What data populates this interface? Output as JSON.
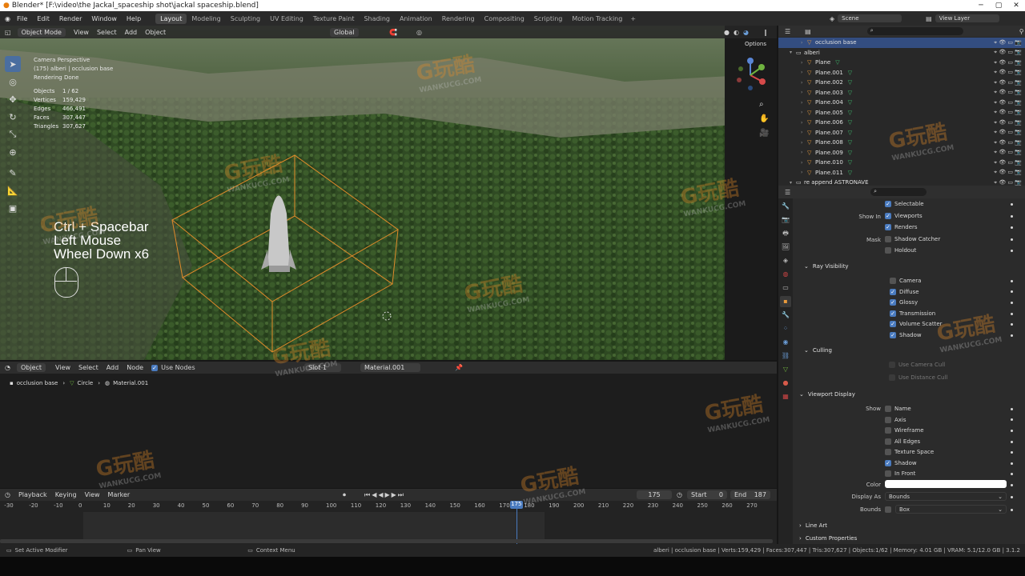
{
  "window": {
    "title": "Blender* [F:\\video\\the Jackal_spaceship shot\\jackal spaceship.blend]"
  },
  "menu": [
    "File",
    "Edit",
    "Render",
    "Window",
    "Help"
  ],
  "workspaces": [
    "Layout",
    "Modeling",
    "Sculpting",
    "UV Editing",
    "Texture Paint",
    "Shading",
    "Animation",
    "Rendering",
    "Compositing",
    "Scripting",
    "Motion Tracking"
  ],
  "active_workspace": "Layout",
  "topright": {
    "scene": "Scene",
    "view_layer": "View Layer"
  },
  "viewport": {
    "mode": "Object Mode",
    "menus": [
      "View",
      "Select",
      "Add",
      "Object"
    ],
    "transform": "Global",
    "options": "Options",
    "overlay_lines": [
      "Camera Perspective",
      "(175) alberi | occlusion base",
      "Rendering Done"
    ],
    "stats": [
      {
        "label": "Objects",
        "value": "1 / 62"
      },
      {
        "label": "Vertices",
        "value": "159,429"
      },
      {
        "label": "Edges",
        "value": "466,491"
      },
      {
        "label": "Faces",
        "value": "307,447"
      },
      {
        "label": "Triangles",
        "value": "307,627"
      }
    ],
    "shortcut_lines": [
      "Ctrl + Spacebar",
      "Left Mouse",
      "Wheel Down x6"
    ]
  },
  "outliner": {
    "items": [
      {
        "name": "occlusion base",
        "selected": true
      },
      {
        "name": "alberi",
        "collection": true
      },
      {
        "name": "Plane"
      },
      {
        "name": "Plane.001"
      },
      {
        "name": "Plane.002"
      },
      {
        "name": "Plane.003"
      },
      {
        "name": "Plane.004"
      },
      {
        "name": "Plane.005"
      },
      {
        "name": "Plane.006"
      },
      {
        "name": "Plane.007"
      },
      {
        "name": "Plane.008"
      },
      {
        "name": "Plane.009"
      },
      {
        "name": "Plane.010"
      },
      {
        "name": "Plane.011"
      },
      {
        "name": "re append ASTRONAVE",
        "collection": true
      }
    ]
  },
  "properties": {
    "visibility": {
      "selectable": "Selectable",
      "show_in_label": "Show In",
      "viewports": "Viewports",
      "renders": "Renders",
      "mask_label": "Mask",
      "shadow_catcher": "Shadow Catcher",
      "holdout": "Holdout"
    },
    "ray_visibility": {
      "title": "Ray Visibility",
      "items": [
        {
          "label": "Camera",
          "checked": false
        },
        {
          "label": "Diffuse",
          "checked": true
        },
        {
          "label": "Glossy",
          "checked": true
        },
        {
          "label": "Transmission",
          "checked": true
        },
        {
          "label": "Volume Scatter",
          "checked": true
        },
        {
          "label": "Shadow",
          "checked": true
        }
      ]
    },
    "culling": {
      "title": "Culling",
      "use_camera_cull": "Use Camera Cull",
      "use_distance_cull": "Use Distance Cull"
    },
    "viewport_display": {
      "title": "Viewport Display",
      "show_label": "Show",
      "items": [
        {
          "label": "Name",
          "checked": false
        },
        {
          "label": "Axis",
          "checked": false
        },
        {
          "label": "Wireframe",
          "checked": false
        },
        {
          "label": "All Edges",
          "checked": false
        },
        {
          "label": "Texture Space",
          "checked": false
        },
        {
          "label": "Shadow",
          "checked": true
        },
        {
          "label": "In Front",
          "checked": false
        }
      ],
      "color_label": "Color",
      "display_as_label": "Display As",
      "display_as_value": "Bounds",
      "bounds_label": "Bounds",
      "bounds_value": "Box"
    },
    "line_art": "Line Art",
    "custom_properties": "Custom Properties"
  },
  "node_editor": {
    "type": "Object",
    "menus": [
      "View",
      "Select",
      "Add",
      "Node"
    ],
    "use_nodes": "Use Nodes",
    "slot": "Slot 1",
    "material": "Material.001",
    "breadcrumb": [
      "occlusion base",
      "Circle",
      "Material.001"
    ]
  },
  "timeline": {
    "menus": [
      "Playback",
      "Keying",
      "View",
      "Marker"
    ],
    "current_frame": "175",
    "start_label": "Start",
    "start": "0",
    "end_label": "End",
    "end": "187",
    "ticks": [
      "-30",
      "-20",
      "-10",
      "0",
      "10",
      "20",
      "30",
      "40",
      "50",
      "60",
      "70",
      "80",
      "90",
      "100",
      "110",
      "120",
      "130",
      "140",
      "150",
      "160",
      "170",
      "180",
      "190",
      "200",
      "210",
      "220",
      "230",
      "240",
      "250",
      "260",
      "270"
    ],
    "playhead": 175
  },
  "statusbar": {
    "left": [
      "Set Active Modifier",
      "Pan View",
      "Context Menu"
    ],
    "right": "alberi | occlusion base | Verts:159,429 | Faces:307,447 | Tris:307,627 | Objects:1/62 | Memory: 4.01 GB | VRAM: 5.1/12.0 GB | 3.1.2"
  },
  "watermark": {
    "brand": "G玩酷",
    "site": "WANKUCG.COM"
  }
}
